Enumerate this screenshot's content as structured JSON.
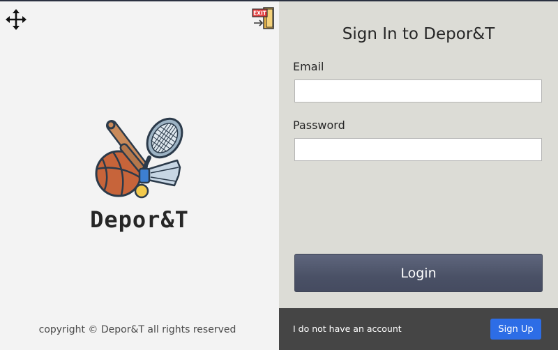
{
  "left_panel": {
    "brand": "Depor&T",
    "copyright": "copyright © Depor&T all rights reserved",
    "icons": {
      "move": "move-arrows-icon",
      "exit": "exit-door-icon",
      "logo": "sports-equipment-logo"
    }
  },
  "form": {
    "title": "Sign In to Depor&T",
    "email_label": "Email",
    "email_value": "",
    "password_label": "Password",
    "password_value": "",
    "login_label": "Login"
  },
  "footer": {
    "no_account_text": "I do not have an account",
    "signup_label": "Sign Up"
  },
  "colors": {
    "left_bg": "#f3f3f3",
    "right_bg": "#dcdcd6",
    "login_button": "#4a5166",
    "footer_bg": "#454545",
    "signup_button": "#2d6de6"
  }
}
